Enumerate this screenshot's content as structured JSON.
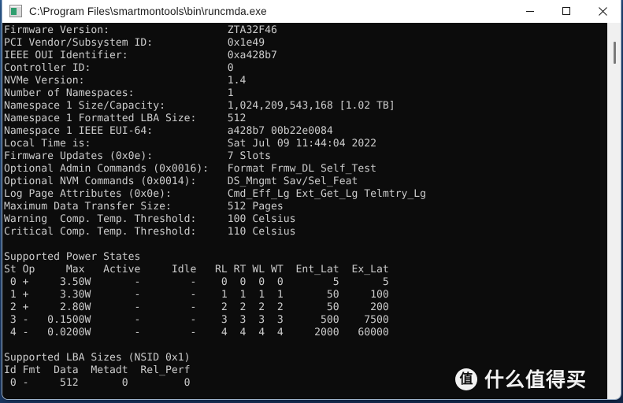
{
  "window": {
    "title": "C:\\Program Files\\smartmontools\\bin\\runcmda.exe",
    "icon": "console-window-icon",
    "controls": {
      "minimize_label": "Minimize",
      "maximize_label": "Maximize",
      "close_label": "Close"
    },
    "titlebar_bg": "#ffffff",
    "terminal_bg": "#0c0c0c",
    "terminal_fg": "#cccccc",
    "desktop_bg": "#1d3f6e"
  },
  "console": {
    "info_rows": [
      {
        "label": "Firmware Version:",
        "value": "ZTA32F46"
      },
      {
        "label": "PCI Vendor/Subsystem ID:",
        "value": "0x1e49"
      },
      {
        "label": "IEEE OUI Identifier:",
        "value": "0xa428b7"
      },
      {
        "label": "Controller ID:",
        "value": "0"
      },
      {
        "label": "NVMe Version:",
        "value": "1.4"
      },
      {
        "label": "Number of Namespaces:",
        "value": "1"
      },
      {
        "label": "Namespace 1 Size/Capacity:",
        "value": "1,024,209,543,168 [1.02 TB]"
      },
      {
        "label": "Namespace 1 Formatted LBA Size:",
        "value": "512"
      },
      {
        "label": "Namespace 1 IEEE EUI-64:",
        "value": "a428b7 00b22e0084"
      },
      {
        "label": "Local Time is:",
        "value": "Sat Jul 09 11:44:04 2022"
      },
      {
        "label": "Firmware Updates (0x0e):",
        "value": "7 Slots"
      },
      {
        "label": "Optional Admin Commands (0x0016):",
        "value": "Format Frmw_DL Self_Test"
      },
      {
        "label": "Optional NVM Commands (0x0014):",
        "value": "DS_Mngmt Sav/Sel_Feat"
      },
      {
        "label": "Log Page Attributes (0x0e):",
        "value": "Cmd_Eff_Lg Ext_Get_Lg Telmtry_Lg"
      },
      {
        "label": "Maximum Data Transfer Size:",
        "value": "512 Pages"
      },
      {
        "label": "Warning  Comp. Temp. Threshold:",
        "value": "100 Celsius"
      },
      {
        "label": "Critical Comp. Temp. Threshold:",
        "value": "110 Celsius"
      }
    ],
    "power_states": {
      "title": "Supported Power States",
      "headers": [
        "St",
        "Op",
        "Max",
        "Active",
        "Idle",
        "RL",
        "RT",
        "WL",
        "WT",
        "Ent_Lat",
        "Ex_Lat"
      ],
      "rows": [
        [
          "0",
          "+",
          "3.50W",
          "-",
          "-",
          "0",
          "0",
          "0",
          "0",
          "5",
          "5"
        ],
        [
          "1",
          "+",
          "3.30W",
          "-",
          "-",
          "1",
          "1",
          "1",
          "1",
          "50",
          "100"
        ],
        [
          "2",
          "+",
          "2.80W",
          "-",
          "-",
          "2",
          "2",
          "2",
          "2",
          "50",
          "200"
        ],
        [
          "3",
          "-",
          "0.1500W",
          "-",
          "-",
          "3",
          "3",
          "3",
          "3",
          "500",
          "7500"
        ],
        [
          "4",
          "-",
          "0.0200W",
          "-",
          "-",
          "4",
          "4",
          "4",
          "4",
          "2000",
          "60000"
        ]
      ]
    },
    "lba_sizes": {
      "title": "Supported LBA Sizes (NSID 0x1)",
      "headers": [
        "Id",
        "Fmt",
        "Data",
        "Metadt",
        "Rel_Perf"
      ],
      "rows": [
        [
          "0",
          "-",
          "512",
          "0",
          "0"
        ]
      ]
    },
    "raw_text": "Firmware Version:                   ZTA32F46\nPCI Vendor/Subsystem ID:            0x1e49\nIEEE OUI Identifier:                0xa428b7\nController ID:                      0\nNVMe Version:                       1.4\nNumber of Namespaces:               1\nNamespace 1 Size/Capacity:          1,024,209,543,168 [1.02 TB]\nNamespace 1 Formatted LBA Size:     512\nNamespace 1 IEEE EUI-64:            a428b7 00b22e0084\nLocal Time is:                      Sat Jul 09 11:44:04 2022\nFirmware Updates (0x0e):            7 Slots\nOptional Admin Commands (0x0016):   Format Frmw_DL Self_Test\nOptional NVM Commands (0x0014):     DS_Mngmt Sav/Sel_Feat\nLog Page Attributes (0x0e):         Cmd_Eff_Lg Ext_Get_Lg Telmtry_Lg\nMaximum Data Transfer Size:         512 Pages\nWarning  Comp. Temp. Threshold:     100 Celsius\nCritical Comp. Temp. Threshold:     110 Celsius\n\nSupported Power States\nSt Op     Max   Active     Idle   RL RT WL WT  Ent_Lat  Ex_Lat\n 0 +     3.50W       -        -    0  0  0  0        5       5\n 1 +     3.30W       -        -    1  1  1  1       50     100\n 2 +     2.80W       -        -    2  2  2  2       50     200\n 3 -   0.1500W       -        -    3  3  3  3      500    7500\n 4 -   0.0200W       -        -    4  4  4  4     2000   60000\n\nSupported LBA Sizes (NSID 0x1)\nId Fmt  Data  Metadt  Rel_Perf\n 0 -     512       0         0"
  },
  "scrollbar": {
    "orientation": "vertical",
    "thumb_position": "near-top"
  },
  "watermark": {
    "badge": "值",
    "text": "什么值得买"
  }
}
